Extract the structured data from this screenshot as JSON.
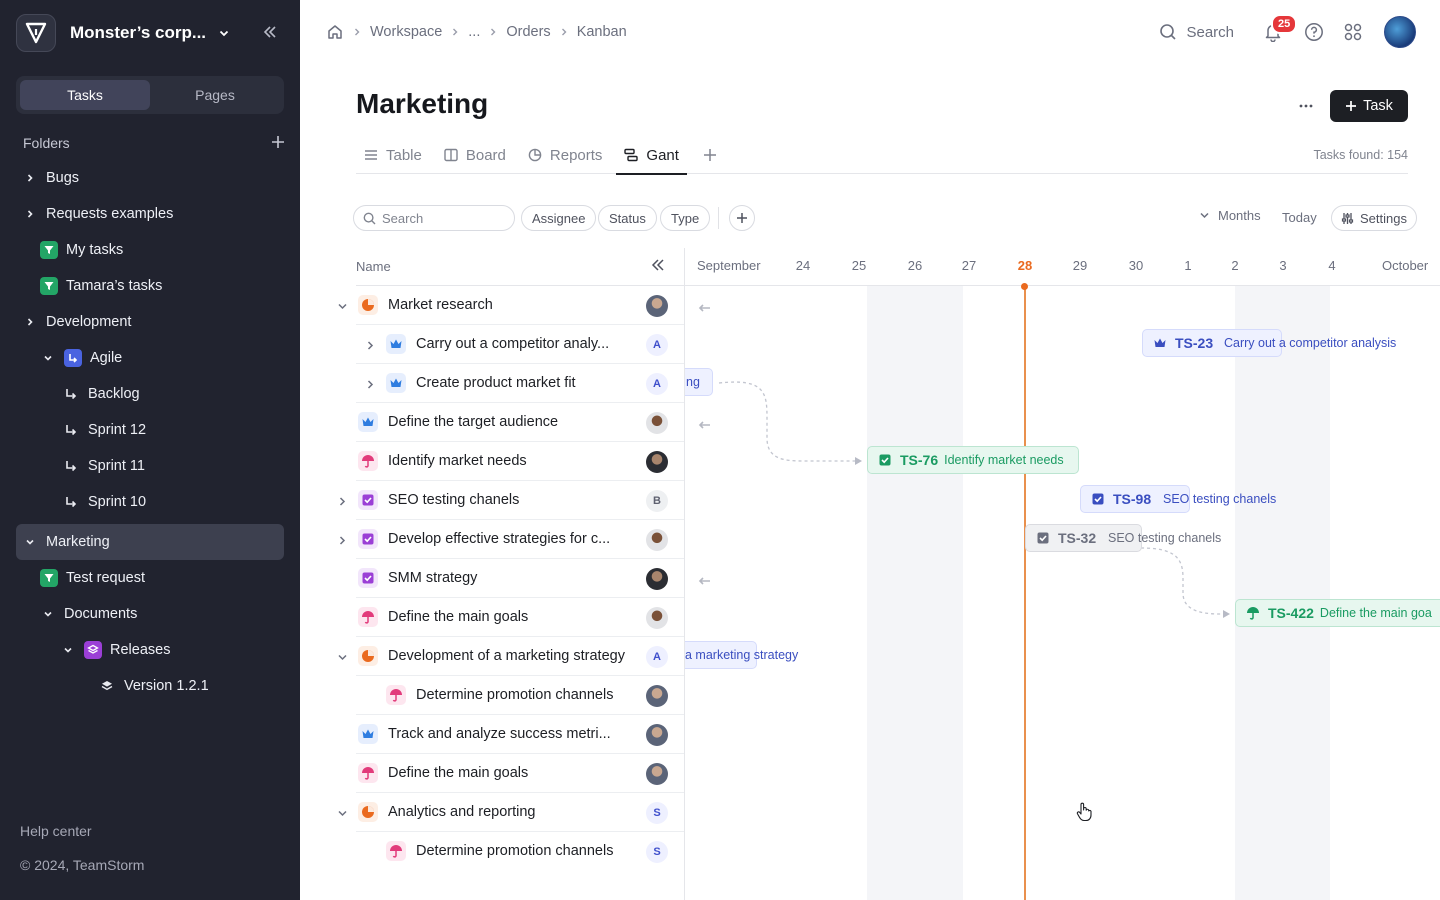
{
  "sidebar": {
    "workspace_name": "Monster’s corp...",
    "segments": [
      "Tasks",
      "Pages"
    ],
    "folders_label": "Folders",
    "tree": [
      {
        "label": "Bugs"
      },
      {
        "label": "Requests examples"
      },
      {
        "label": "My tasks"
      },
      {
        "label": "Tamara’s tasks"
      },
      {
        "label": "Development"
      },
      {
        "label": "Agile"
      },
      {
        "label": "Backlog"
      },
      {
        "label": "Sprint 12"
      },
      {
        "label": "Sprint 11"
      },
      {
        "label": "Sprint 10"
      },
      {
        "label": "Marketing"
      },
      {
        "label": "Test request"
      },
      {
        "label": "Documents"
      },
      {
        "label": "Releases"
      },
      {
        "label": "Version 1.2.1"
      }
    ],
    "help_center": "Help center",
    "copyright": "© 2024, TeamStorm"
  },
  "breadcrumb": [
    "Workspace",
    "...",
    "Orders",
    "Kanban"
  ],
  "topbar": {
    "search_label": "Search",
    "notification_count": "25"
  },
  "page": {
    "title": "Marketing",
    "task_button": "Task",
    "tasks_found": "Tasks found: 154",
    "tabs": [
      "Table",
      "Board",
      "Reports",
      "Gant"
    ]
  },
  "filters": {
    "search_placeholder": "Search",
    "chips": [
      "Assignee",
      "Status",
      "Type"
    ],
    "months": "Months",
    "today": "Today",
    "settings": "Settings"
  },
  "list": {
    "name_header": "Name",
    "rows": [
      {
        "name": "Market research",
        "avatar": ""
      },
      {
        "name": "Carry out a competitor analy...",
        "avatar": "A"
      },
      {
        "name": "Create product market fit",
        "avatar": "A"
      },
      {
        "name": "Define the target audience",
        "avatar": ""
      },
      {
        "name": "Identify market needs",
        "avatar": ""
      },
      {
        "name": "SEO testing chanels",
        "avatar": "B"
      },
      {
        "name": "Develop effective strategies for c...",
        "avatar": ""
      },
      {
        "name": "SMM strategy",
        "avatar": ""
      },
      {
        "name": "Define the main goals",
        "avatar": ""
      },
      {
        "name": "Development of a marketing strategy",
        "avatar": "A"
      },
      {
        "name": "Determine promotion channels",
        "avatar": ""
      },
      {
        "name": "Track and analyze success metri...",
        "avatar": ""
      },
      {
        "name": "Define the main goals",
        "avatar": ""
      },
      {
        "name": "Analytics and reporting",
        "avatar": "S"
      },
      {
        "name": "Determine promotion channels",
        "avatar": "S"
      }
    ]
  },
  "gantt": {
    "months": [
      "September",
      "October"
    ],
    "days": [
      "24",
      "25",
      "26",
      "27",
      "28",
      "29",
      "30",
      "1",
      "2",
      "3",
      "4"
    ],
    "today": "28",
    "bars": [
      {
        "key": "TS-23",
        "title": "Carry out a competitor analysis"
      },
      {
        "key": "",
        "title": "ng"
      },
      {
        "key": "TS-76",
        "title": "Identify market needs"
      },
      {
        "key": "TS-98",
        "title": "SEO testing chanels"
      },
      {
        "key": "TS-32",
        "title": "SEO testing chanels"
      },
      {
        "key": "TS-422",
        "title": "Define the main goa"
      },
      {
        "key": "",
        "title": "a marketing strategy"
      }
    ]
  },
  "colors": {
    "sidebar_bg": "#21232f",
    "accent_today": "#ea6a1f",
    "green": "#1a9b62",
    "blue": "#3a4ec0",
    "badge": "#e5373a"
  }
}
